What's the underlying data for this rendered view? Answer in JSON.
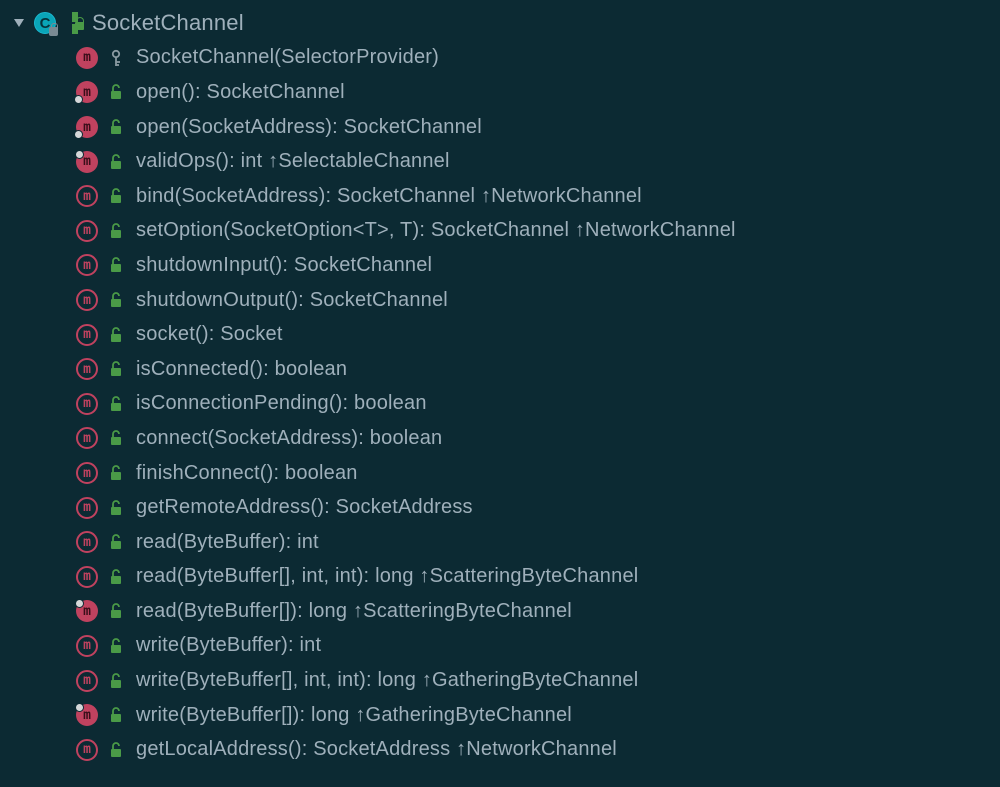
{
  "header": {
    "name": "SocketChannel"
  },
  "colors": {
    "bg": "#0c2a33",
    "text": "#9fb0bb",
    "methodCircle": "#c0425f",
    "classCircle": "#0aa5b8",
    "lockGreen": "#4a9a47",
    "keyGrey": "#8a9aa2"
  },
  "members": [
    {
      "icon": "method-solid",
      "decor": "none",
      "vis": "key",
      "sig": "SocketChannel(SelectorProvider)"
    },
    {
      "icon": "method-solid",
      "decor": "dot",
      "vis": "lock",
      "sig": "open(): SocketChannel"
    },
    {
      "icon": "method-solid",
      "decor": "dot",
      "vis": "lock",
      "sig": "open(SocketAddress): SocketChannel"
    },
    {
      "icon": "method-solid",
      "decor": "pin",
      "vis": "lock",
      "sig": "validOps(): int ↑SelectableChannel"
    },
    {
      "icon": "method-abstract",
      "decor": "none",
      "vis": "lock",
      "sig": "bind(SocketAddress): SocketChannel ↑NetworkChannel"
    },
    {
      "icon": "method-abstract",
      "decor": "none",
      "vis": "lock",
      "sig": "setOption(SocketOption<T>, T): SocketChannel ↑NetworkChannel"
    },
    {
      "icon": "method-abstract",
      "decor": "none",
      "vis": "lock",
      "sig": "shutdownInput(): SocketChannel"
    },
    {
      "icon": "method-abstract",
      "decor": "none",
      "vis": "lock",
      "sig": "shutdownOutput(): SocketChannel"
    },
    {
      "icon": "method-abstract",
      "decor": "none",
      "vis": "lock",
      "sig": "socket(): Socket"
    },
    {
      "icon": "method-abstract",
      "decor": "none",
      "vis": "lock",
      "sig": "isConnected(): boolean"
    },
    {
      "icon": "method-abstract",
      "decor": "none",
      "vis": "lock",
      "sig": "isConnectionPending(): boolean"
    },
    {
      "icon": "method-abstract",
      "decor": "none",
      "vis": "lock",
      "sig": "connect(SocketAddress): boolean"
    },
    {
      "icon": "method-abstract",
      "decor": "none",
      "vis": "lock",
      "sig": "finishConnect(): boolean"
    },
    {
      "icon": "method-abstract",
      "decor": "none",
      "vis": "lock",
      "sig": "getRemoteAddress(): SocketAddress"
    },
    {
      "icon": "method-abstract",
      "decor": "none",
      "vis": "lock",
      "sig": "read(ByteBuffer): int"
    },
    {
      "icon": "method-abstract",
      "decor": "none",
      "vis": "lock",
      "sig": "read(ByteBuffer[], int, int): long ↑ScatteringByteChannel"
    },
    {
      "icon": "method-solid",
      "decor": "pin",
      "vis": "lock",
      "sig": "read(ByteBuffer[]): long ↑ScatteringByteChannel"
    },
    {
      "icon": "method-abstract",
      "decor": "none",
      "vis": "lock",
      "sig": "write(ByteBuffer): int"
    },
    {
      "icon": "method-abstract",
      "decor": "none",
      "vis": "lock",
      "sig": "write(ByteBuffer[], int, int): long ↑GatheringByteChannel"
    },
    {
      "icon": "method-solid",
      "decor": "pin",
      "vis": "lock",
      "sig": "write(ByteBuffer[]): long ↑GatheringByteChannel"
    },
    {
      "icon": "method-abstract",
      "decor": "none",
      "vis": "lock",
      "sig": "getLocalAddress(): SocketAddress ↑NetworkChannel"
    }
  ]
}
